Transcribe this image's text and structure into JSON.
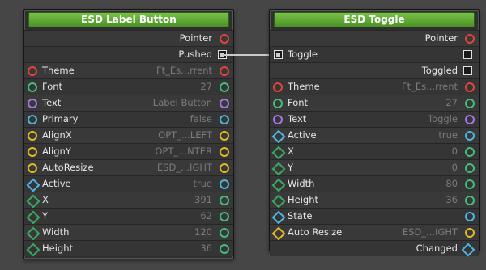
{
  "nodes": {
    "label_button": {
      "title": "ESD Label Button",
      "outputs": [
        {
          "label": "Pointer",
          "pin": "circle",
          "color": "#e2443b"
        },
        {
          "label": "Pushed",
          "pin": "square"
        }
      ],
      "inputs": [
        {
          "label": "Theme",
          "value": "Ft_Es...rrent",
          "pin": "circle",
          "color": "#e2443b"
        },
        {
          "label": "Font",
          "value": "27",
          "pin": "circle",
          "color": "#3fbf7a"
        },
        {
          "label": "Text",
          "value": "Label Button",
          "pin": "circle",
          "color": "#a675e8"
        },
        {
          "label": "Primary",
          "value": "false",
          "pin": "circle",
          "color": "#4ab7e4"
        },
        {
          "label": "AlignX",
          "value": "OPT_...LEFT",
          "pin": "circle",
          "color": "#e6b823"
        },
        {
          "label": "AlignY",
          "value": "OPT_...NTER",
          "pin": "circle",
          "color": "#e6b823"
        },
        {
          "label": "AutoResize",
          "value": "ESD_...IGHT",
          "pin": "circle",
          "color": "#e6b823"
        },
        {
          "label": "Active",
          "value": "true",
          "pin": "diamond",
          "color": "#4eb5e6"
        },
        {
          "label": "X",
          "value": "391",
          "pin": "diamond",
          "color": "#3aa865"
        },
        {
          "label": "Y",
          "value": "62",
          "pin": "diamond",
          "color": "#3aa865"
        },
        {
          "label": "Width",
          "value": "120",
          "pin": "diamond",
          "color": "#3aa865"
        },
        {
          "label": "Height",
          "value": "36",
          "pin": "diamond",
          "color": "#3aa865"
        }
      ]
    },
    "toggle": {
      "title": "ESD Toggle",
      "pointer": "Pointer",
      "toggle_input": "Toggle",
      "toggled": "Toggled",
      "inputs": [
        {
          "label": "Theme",
          "value": "Ft_Es...rrent"
        },
        {
          "label": "Font",
          "value": "27"
        },
        {
          "label": "Text",
          "value": "Toggle"
        },
        {
          "label": "Active",
          "value": "true"
        },
        {
          "label": "X",
          "value": "0"
        },
        {
          "label": "Y",
          "value": "0"
        },
        {
          "label": "Width",
          "value": "80"
        },
        {
          "label": "Height",
          "value": "36"
        },
        {
          "label": "State",
          "value": ""
        },
        {
          "label": "Auto Resize",
          "value": "ESD_...IGHT"
        }
      ],
      "changed": "Changed"
    }
  },
  "colors": {
    "title_green": "#5aa82f",
    "red": "#e2443b",
    "green": "#3fbf7a",
    "purple": "#a675e8",
    "cyan": "#4ab7e4",
    "yellow": "#e6b823"
  }
}
